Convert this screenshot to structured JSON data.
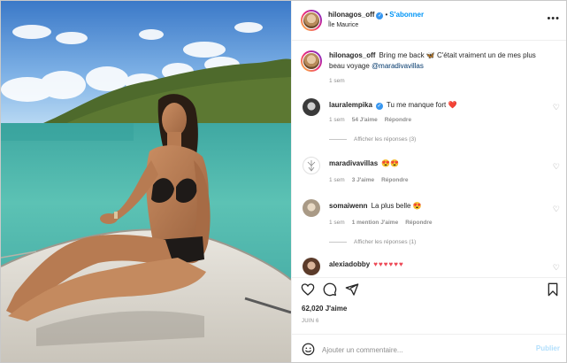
{
  "post": {
    "author": "hilonagos_off",
    "follow_label": "S'abonner",
    "location": "Île Maurice",
    "more_label": "•••",
    "caption": {
      "author": "hilonagos_off",
      "text": "Bring me back 🦋 C'était vraiment un de mes plus beau voyage",
      "mention": "@maradivavillas",
      "age": "1 sem"
    }
  },
  "comments": [
    {
      "author": "lauralempika",
      "verified": true,
      "text": "Tu me manque fort",
      "emoji": "❤️",
      "age": "1 sem",
      "likes": "54 J'aime",
      "reply_label": "Répondre",
      "replies_label": "Afficher les réponses (3)"
    },
    {
      "author": "maradivavillas",
      "verified": false,
      "text": "",
      "emoji": "😍😍",
      "age": "1 sem",
      "likes": "3 J'aime",
      "reply_label": "Répondre",
      "replies_label": ""
    },
    {
      "author": "somaiwenn",
      "verified": false,
      "text": "La plus belle",
      "emoji": "😍",
      "age": "1 sem",
      "likes": "1 mention J'aime",
      "reply_label": "Répondre",
      "replies_label": "Afficher les réponses (1)"
    },
    {
      "author": "alexiadobby",
      "verified": false,
      "text": "",
      "emoji": "♥♥♥♥♥♥",
      "age": "",
      "likes": "",
      "reply_label": "",
      "replies_label": ""
    }
  ],
  "actions": {
    "likes_count": "62,020 J'aime",
    "date": "JUIN 6"
  },
  "add_comment": {
    "placeholder": "Ajouter un commentaire...",
    "post_label": "Publier"
  },
  "colors": {
    "accent": "#0095f6",
    "heart": "#ed4956",
    "muted": "#8e8e8e",
    "verified": "#3897f0"
  },
  "icons": [
    "more-icon",
    "verified-icon",
    "heart-icon",
    "comment-icon",
    "share-icon",
    "bookmark-icon",
    "emoji-icon"
  ]
}
